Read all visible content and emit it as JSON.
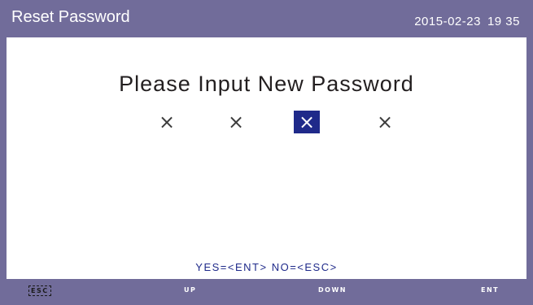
{
  "header": {
    "title": "Reset Password",
    "date": "2015-02-23",
    "time": "19 35"
  },
  "main": {
    "prompt": "Please Input New Password",
    "digits": [
      "×",
      "×",
      "×",
      "×"
    ],
    "selected_digit_index": 2
  },
  "confirm_hint": "YES=<ENT>  NO=<ESC>",
  "buttons": {
    "esc": "ESC",
    "up": "UP",
    "down": "DOWN",
    "ent": "ENT"
  },
  "colors": {
    "bar_background": "#716c9a",
    "selection": "#1f2a8a",
    "hint_text": "#1f2a8a"
  }
}
